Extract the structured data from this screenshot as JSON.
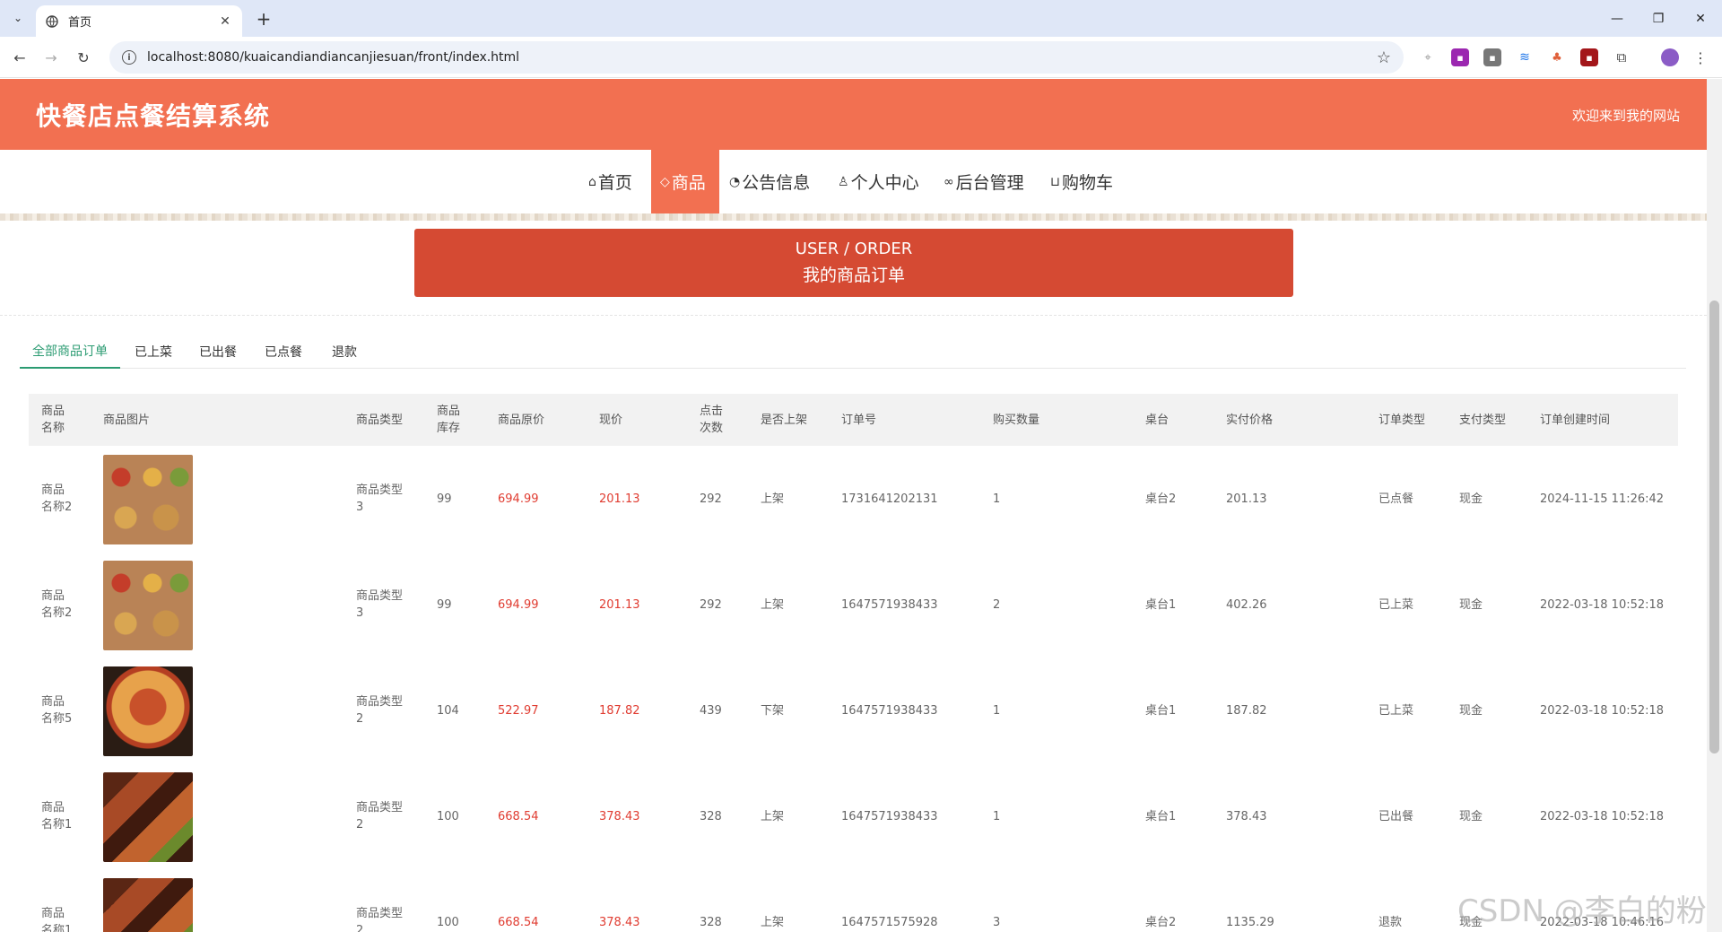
{
  "browser": {
    "tab_title": "首页",
    "url": "localhost:8080/kuaicandiandiancanjiesuan/front/index.html"
  },
  "site": {
    "title": "快餐店点餐结算系统",
    "welcome": "欢迎来到我的网站"
  },
  "nav": [
    {
      "label": "首页",
      "icon": "home-icon",
      "active": false
    },
    {
      "label": "商品",
      "icon": "tag-icon",
      "active": true
    },
    {
      "label": "公告信息",
      "icon": "dashboard-icon",
      "active": false
    },
    {
      "label": "个人中心",
      "icon": "user-icon",
      "active": false
    },
    {
      "label": "后台管理",
      "icon": "link-icon",
      "active": false
    },
    {
      "label": "购物车",
      "icon": "cart-icon",
      "active": false
    }
  ],
  "banner": {
    "line1": "USER / ORDER",
    "line2": "我的商品订单"
  },
  "subtabs": [
    "全部商品订单",
    "已上菜",
    "已出餐",
    "已点餐",
    "退款"
  ],
  "table": {
    "headers": [
      "商品\n名称",
      "商品图片",
      "商品类型",
      "商品\n库存",
      "商品原价",
      "现价",
      "点击\n次数",
      "是否上架",
      "订单号",
      "购买数量",
      "桌台",
      "实付价格",
      "订单类型",
      "支付类型",
      "订单创建时间"
    ],
    "rows": [
      {
        "name": "商品\n名称2",
        "type": "商品类型\n3",
        "stock": "99",
        "orig": "694.99",
        "price": "201.13",
        "clicks": "292",
        "listed": "上架",
        "order_no": "1731641202131",
        "qty": "1",
        "table": "桌台2",
        "paid": "201.13",
        "status": "已点餐",
        "pay": "现金",
        "time": "2024-11-15 11:26:42"
      },
      {
        "name": "商品\n名称2",
        "type": "商品类型\n3",
        "stock": "99",
        "orig": "694.99",
        "price": "201.13",
        "clicks": "292",
        "listed": "上架",
        "order_no": "1647571938433",
        "qty": "2",
        "table": "桌台1",
        "paid": "402.26",
        "status": "已上菜",
        "pay": "现金",
        "time": "2022-03-18 10:52:18"
      },
      {
        "name": "商品\n名称5",
        "type": "商品类型\n2",
        "stock": "104",
        "orig": "522.97",
        "price": "187.82",
        "clicks": "439",
        "listed": "下架",
        "order_no": "1647571938433",
        "qty": "1",
        "table": "桌台1",
        "paid": "187.82",
        "status": "已上菜",
        "pay": "现金",
        "time": "2022-03-18 10:52:18"
      },
      {
        "name": "商品\n名称1",
        "type": "商品类型\n2",
        "stock": "100",
        "orig": "668.54",
        "price": "378.43",
        "clicks": "328",
        "listed": "上架",
        "order_no": "1647571938433",
        "qty": "1",
        "table": "桌台1",
        "paid": "378.43",
        "status": "已出餐",
        "pay": "现金",
        "time": "2022-03-18 10:52:18"
      },
      {
        "name": "商品\n名称1",
        "type": "商品类型\n2",
        "stock": "100",
        "orig": "668.54",
        "price": "378.43",
        "clicks": "328",
        "listed": "上架",
        "order_no": "1647571575928",
        "qty": "3",
        "table": "桌台2",
        "paid": "1135.29",
        "status": "退款",
        "pay": "现金",
        "time": "2022-03-18 10:46:16"
      }
    ]
  },
  "watermark": "CSDN @李白的粉",
  "colors": {
    "header": "#f27051",
    "banner": "#d54a33",
    "price": "#e03c31",
    "active_tab": "#2b9b72"
  }
}
